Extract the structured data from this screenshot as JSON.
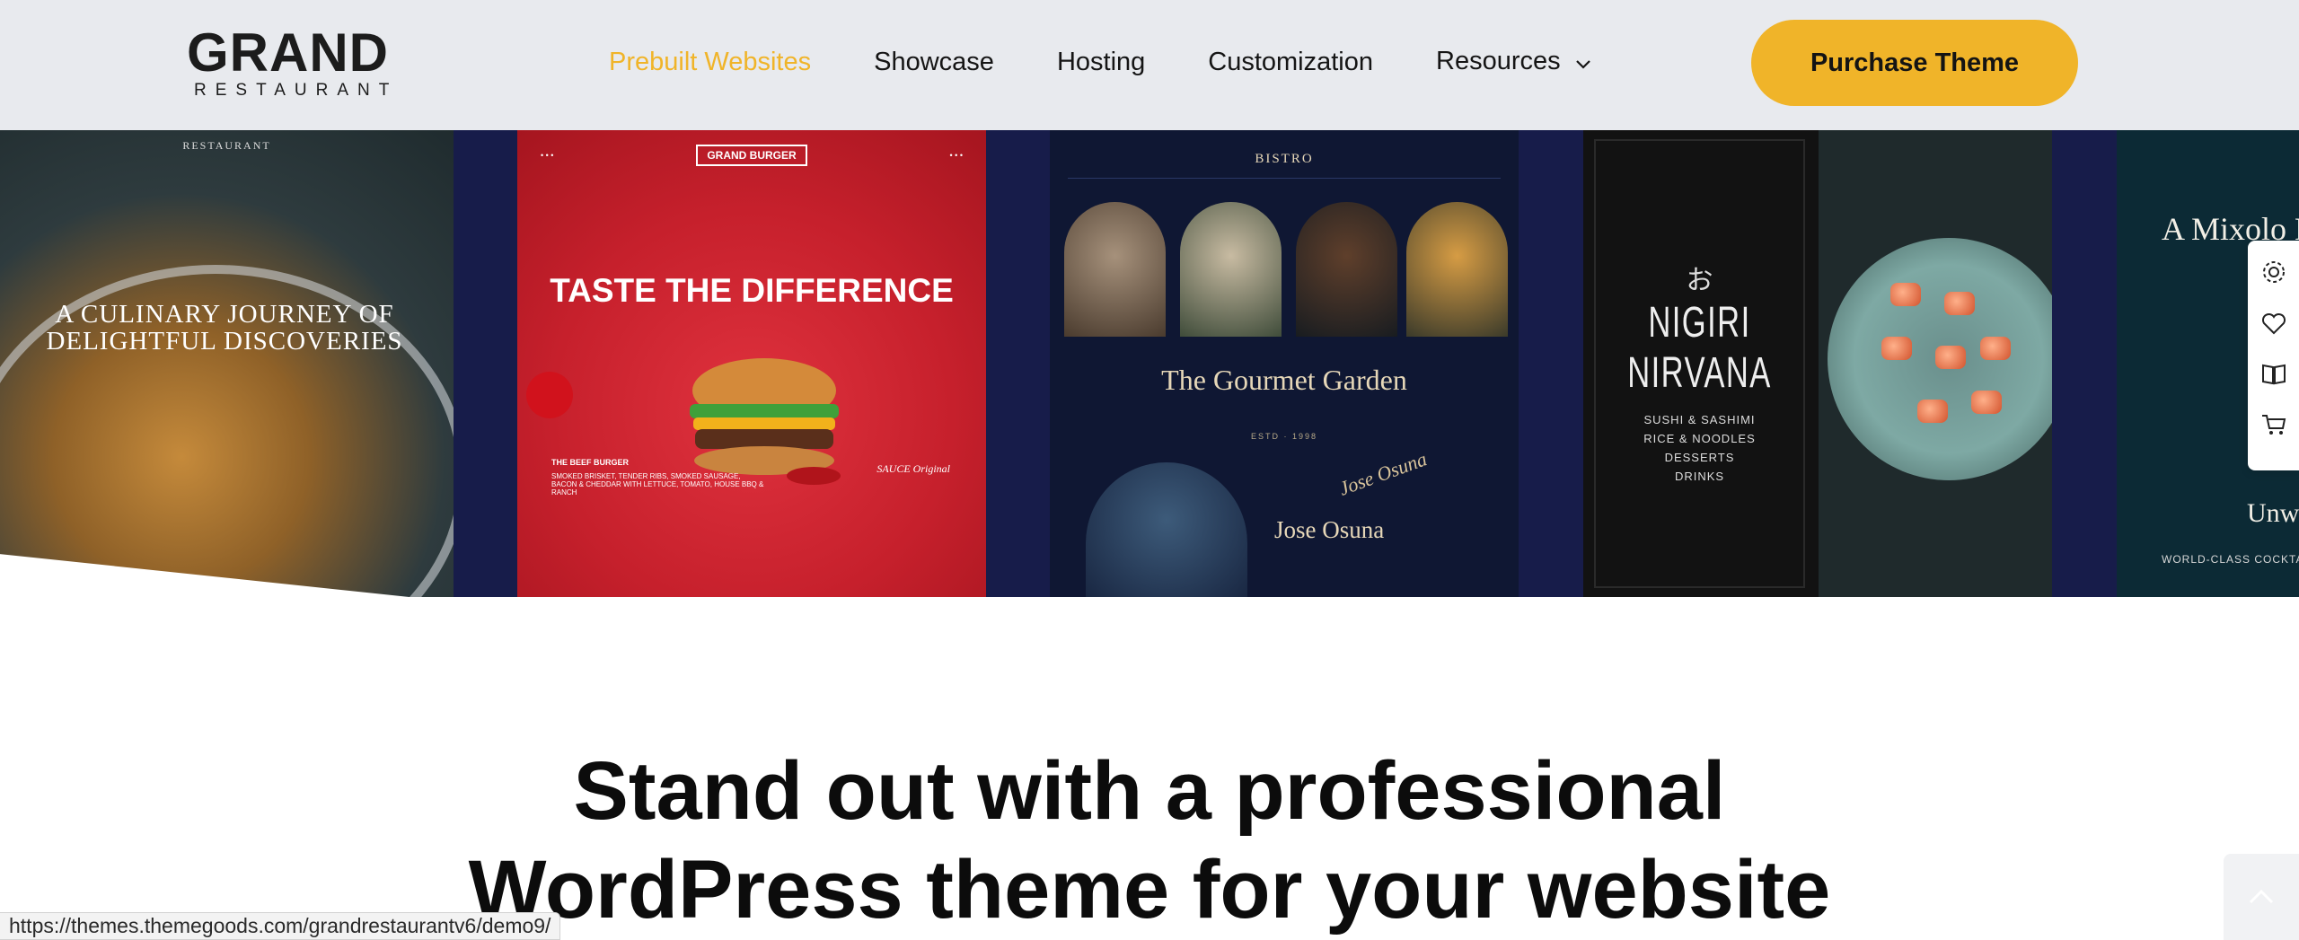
{
  "header": {
    "logo": {
      "main": "GRAND",
      "sub": "RESTAURANT"
    },
    "nav": [
      {
        "label": "Prebuilt Websites",
        "active": true
      },
      {
        "label": "Showcase"
      },
      {
        "label": "Hosting"
      },
      {
        "label": "Customization"
      },
      {
        "label": "Resources",
        "has_dropdown": true
      }
    ],
    "cta_label": "Purchase Theme"
  },
  "gallery": {
    "cards": [
      {
        "brand": "RESTAURANT",
        "headline": "A CULINARY JOURNEY OF DELIGHTFUL DISCOVERIES"
      },
      {
        "brand": "GRAND BURGER",
        "headline": "TASTE THE DIFFERENCE",
        "footer_title": "THE BEEF BURGER",
        "footer_text": "SMOKED BRISKET, TENDER RIBS, SMOKED SAUSAGE, BACON & CHEDDAR WITH LETTUCE, TOMATO, HOUSE BBQ & RANCH",
        "badge": "SAUCE Original"
      },
      {
        "brand": "BISTRO",
        "headline": "The Gourmet Garden",
        "est": "ESTD · 1998",
        "chef_name": "Jose Osuna",
        "signature": "Jose Osuna"
      },
      {
        "glyph": "お",
        "headline": "NIGIRI NIRVANA",
        "menu": [
          "SUSHI & SASHIMI",
          "RICE & NOODLES",
          "DESSERTS",
          "DRINKS"
        ]
      },
      {
        "headline": "A Mixolo Parad",
        "subline": "Unwi",
        "footer_text": "WORLD-CLASS COCKTAILS UNDER"
      }
    ]
  },
  "side_panel": {
    "icons": [
      "gear-icon",
      "heart-icon",
      "book-icon",
      "cart-icon"
    ]
  },
  "hero": {
    "line1": "Stand out with a professional",
    "line2": "WordPress theme for your website"
  },
  "status_url": "https://themes.themegoods.com/grandrestaurantv6/demo9/",
  "colors": {
    "accent": "#f0b429",
    "gallery_bg": "#171c4a",
    "header_bg": "#e8eaee"
  }
}
